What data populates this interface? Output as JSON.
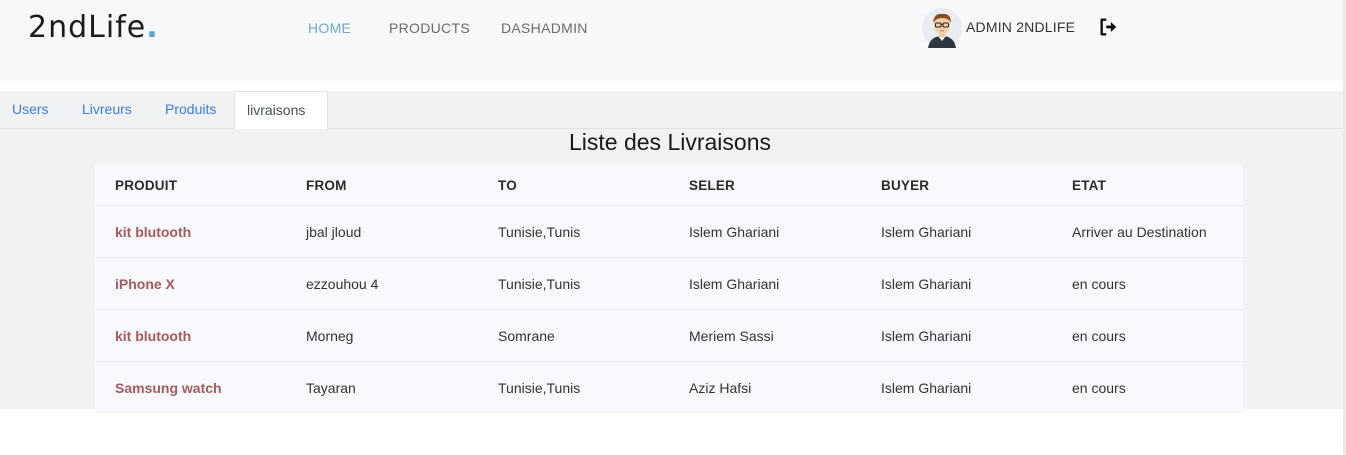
{
  "brand": {
    "name": "2ndLife",
    "dot": "."
  },
  "nav": {
    "items": [
      {
        "label": "HOME",
        "active": true
      },
      {
        "label": "PRODUCTS",
        "active": false
      },
      {
        "label": "DASHADMIN",
        "active": false
      }
    ]
  },
  "user": {
    "name": "ADMIN 2NDLIFE",
    "avatar_icon": "avatar-icon",
    "logout_icon": "logout-icon"
  },
  "tabs": [
    {
      "label": "Users",
      "active": false
    },
    {
      "label": "Livreurs",
      "active": false
    },
    {
      "label": "Produits",
      "active": false
    },
    {
      "label": "livraisons",
      "active": true
    }
  ],
  "page_title": "Liste des Livraisons",
  "table": {
    "columns": [
      "PRODUIT",
      "FROM",
      "TO",
      "SELER",
      "BUYER",
      "ETAT"
    ],
    "rows": [
      [
        "kit blutooth",
        "jbal jloud",
        "Tunisie,Tunis",
        "Islem Ghariani",
        "Islem Ghariani",
        "Arriver au Destination"
      ],
      [
        "iPhone X",
        "ezzouhou 4",
        "Tunisie,Tunis",
        "Islem Ghariani",
        "Islem Ghariani",
        "en cours"
      ],
      [
        "kit blutooth",
        "Morneg",
        "Somrane",
        "Meriem Sassi",
        "Islem Ghariani",
        "en cours"
      ],
      [
        "Samsung watch",
        "Tayaran",
        "Tunisie,Tunis",
        "Aziz Hafsi",
        "Islem Ghariani",
        "en cours"
      ]
    ]
  },
  "colors": {
    "brand_dot": "#5aa3d1",
    "nav_active": "#6fa8c7",
    "tab_link": "#3b7ddd",
    "product_text": "#a55b5b"
  }
}
